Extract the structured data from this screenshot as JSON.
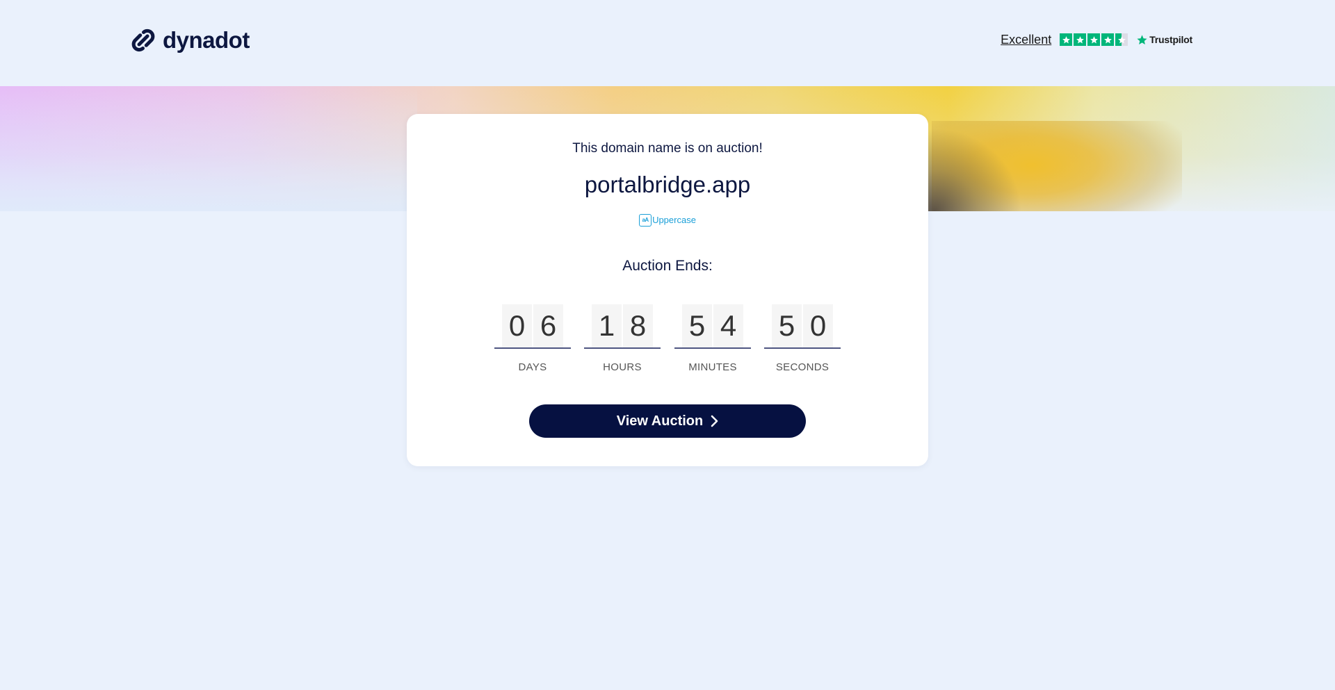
{
  "header": {
    "brand": "dynadot",
    "trustpilot": {
      "rating_text": "Excellent",
      "stars": 4.5,
      "brand": "Trustpilot"
    }
  },
  "card": {
    "subtitle": "This domain name is on auction!",
    "domain": "portalbridge.app",
    "uppercase_link": "Uppercase",
    "uppercase_icon_text": "aA",
    "ends_label": "Auction Ends:",
    "countdown": [
      {
        "label": "DAYS",
        "digits": [
          "0",
          "6"
        ]
      },
      {
        "label": "HOURS",
        "digits": [
          "1",
          "8"
        ]
      },
      {
        "label": "MINUTES",
        "digits": [
          "5",
          "4"
        ]
      },
      {
        "label": "SECONDS",
        "digits": [
          "5",
          "0"
        ]
      }
    ],
    "button_label": "View Auction"
  },
  "colors": {
    "page_background": "#eaf1fc",
    "brand_navy": "#061141",
    "link_blue": "#1a9fd8",
    "trustpilot_green": "#00b67a"
  }
}
